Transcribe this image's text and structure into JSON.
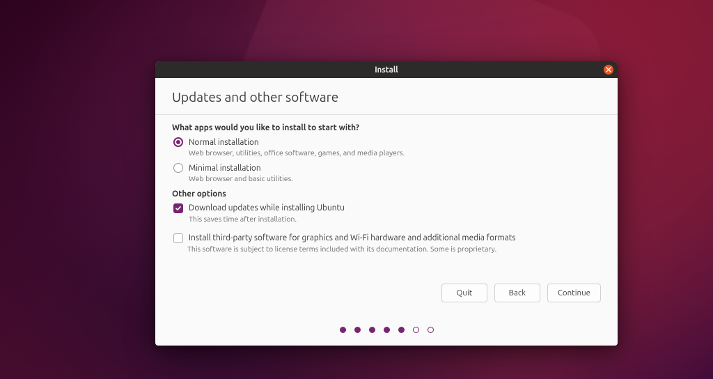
{
  "window": {
    "title": "Install"
  },
  "page": {
    "heading": "Updates and other software"
  },
  "sections": {
    "apps_question": "What apps would you like to install to start with?",
    "normal": {
      "label": "Normal installation",
      "desc": "Web browser, utilities, office software, games, and media players.",
      "selected": true
    },
    "minimal": {
      "label": "Minimal installation",
      "desc": "Web browser and basic utilities.",
      "selected": false
    },
    "other_heading": "Other options",
    "download_updates": {
      "label": "Download updates while installing Ubuntu",
      "desc": "This saves time after installation.",
      "checked": true
    },
    "third_party": {
      "label": "Install third-party software for graphics and Wi-Fi hardware and additional media formats",
      "desc": "This software is subject to license terms included with its documentation. Some is proprietary.",
      "checked": false
    }
  },
  "buttons": {
    "quit": "Quit",
    "back": "Back",
    "continue": "Continue"
  },
  "progress": {
    "total": 7,
    "current": 5
  },
  "colors": {
    "accent": "#762572",
    "close": "#e95420"
  }
}
